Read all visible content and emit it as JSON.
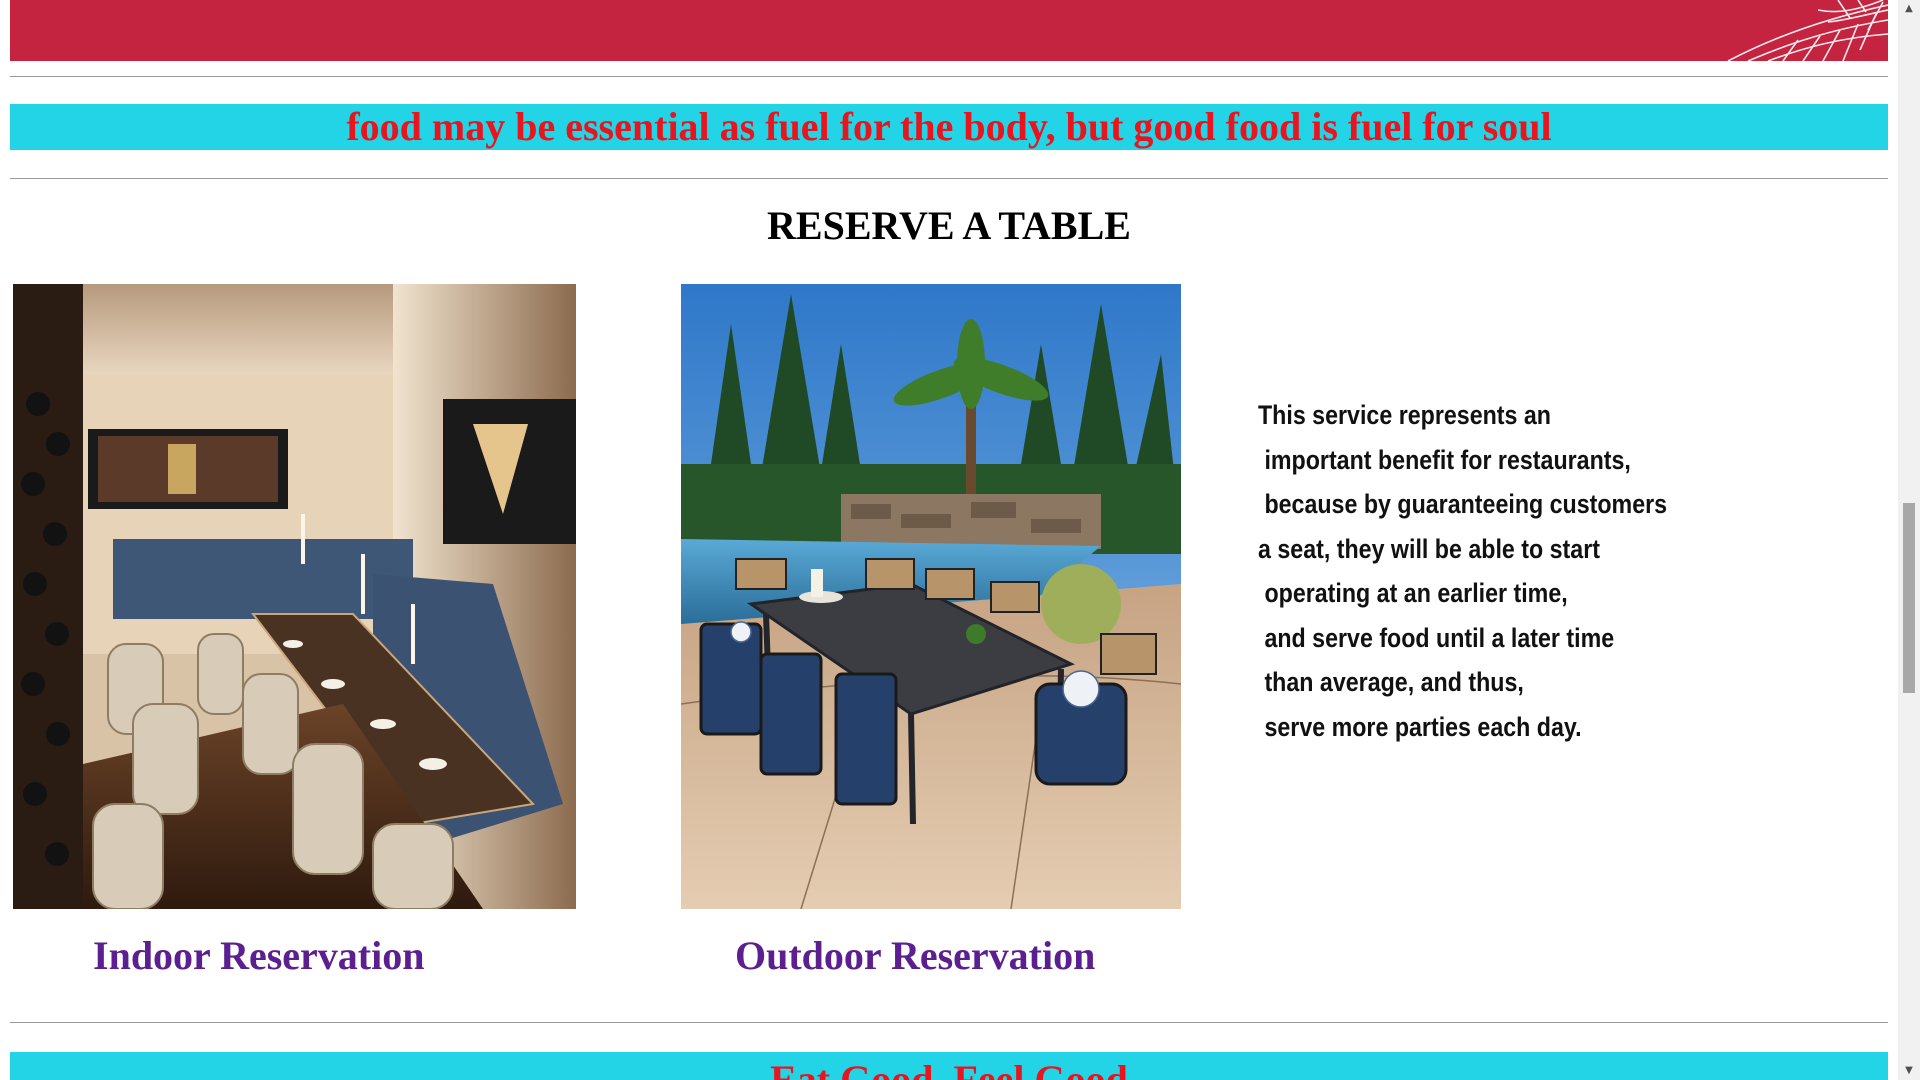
{
  "quote_banner": {
    "text": "food may be essential as fuel for the body, but good food is fuel for soul"
  },
  "section": {
    "title": "RESERVE A TABLE"
  },
  "reservations": [
    {
      "label": "Indoor Reservation"
    },
    {
      "label": "Outdoor Reservation"
    }
  ],
  "description": {
    "lines": [
      "This service represents an",
      " important benefit for restaurants,",
      " because by guaranteeing customers",
      "a seat, they will be able to start",
      " operating at an earlier time,",
      " and serve food until a later time",
      " than average, and thus,",
      " serve more parties each day."
    ]
  },
  "bottom_banner": {
    "text": "Eat Good, Feel Good"
  },
  "colors": {
    "red_banner": "#c4243f",
    "cyan_bar": "#22d4e6",
    "bar_text": "#e8141e",
    "link": "#5b1f8f"
  },
  "icons": {
    "scroll_up": "caret-up-icon",
    "scroll_down": "caret-down-icon"
  }
}
